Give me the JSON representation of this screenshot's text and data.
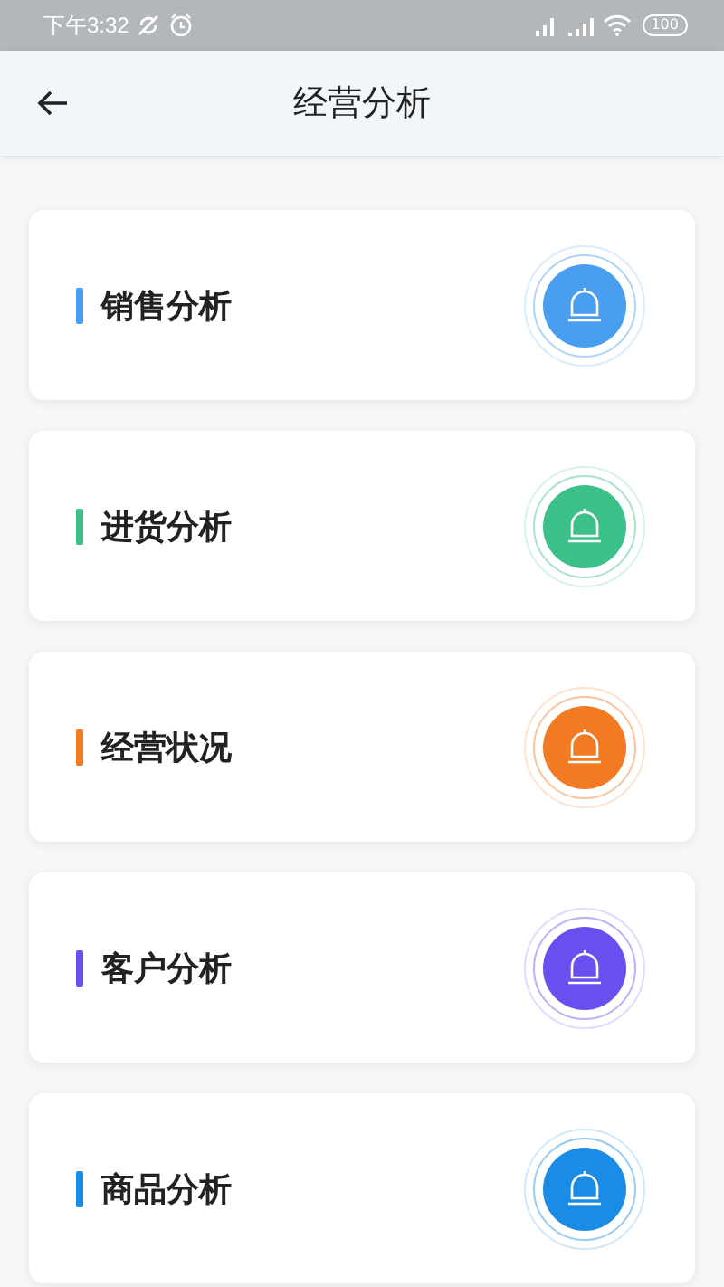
{
  "status_bar": {
    "time": "下午3:32",
    "battery": "100"
  },
  "header": {
    "title": "经营分析"
  },
  "cards": [
    {
      "label": "销售分析",
      "color": "#4a9ef0"
    },
    {
      "label": "进货分析",
      "color": "#3cc08a"
    },
    {
      "label": "经营状况",
      "color": "#f27a22"
    },
    {
      "label": "客户分析",
      "color": "#6a4ef0"
    },
    {
      "label": "商品分析",
      "color": "#1a8ce6"
    }
  ]
}
